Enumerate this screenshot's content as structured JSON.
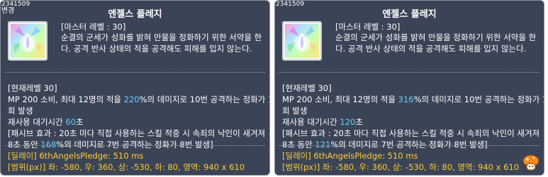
{
  "left": {
    "id": "2341509",
    "change": "변경",
    "title": "엔젤스 플레지",
    "icon": "angels-pledge-skill-icon",
    "master": "[마스터 레벨 : 30]",
    "desc1": "순결의 군세가 성화를 밝혀 만물을 정화하기 위한 서약을 한",
    "desc2": "다. 공격 반사 상태의 적을 공격해도 피해를 입지 않는다.",
    "cur_level": "[현재레벨 30]",
    "l1a": "MP 200 소비, 최대 12명의 적을 ",
    "l1v": "220",
    "l1b": "%의 데미지로 10번 공격하는 정화가 16",
    "l2": "회 발생",
    "l3a": "재사용 대기시간 ",
    "l3v": "60",
    "l3b": "초",
    "l4": "[패시브 효과 : 20초 마다 직접 사용하는 스킬 적중 시 속죄의 낙인이 새겨져",
    "l5a": "8초 동안 ",
    "l5v": "168",
    "l5b": "%의 데미지로 7번 공격하는 정화가 8번 발생]",
    "delay": "[딜레이] 6thAngelsPledge: 510 ms",
    "range": "[범위(px)] 좌: -580, 우: 360, 상: -530, 하: 80, 영역: 940 x 610"
  },
  "right": {
    "id": "2341509",
    "title": "엔젤스 플레지",
    "icon": "angels-pledge-skill-icon",
    "master": "[마스터 레벨 : 30]",
    "desc1": "순결의 군세가 성화를 밝혀 만물을 정화하기 위한 서약을 한",
    "desc2": "다. 공격 반사 상태의 적을 공격해도 피해를 입지 않는다.",
    "cur_level": "[현재레벨 30]",
    "l1a": "MP 200 소비, 최대 12명의 적을 ",
    "l1v": "316",
    "l1b": "%의 데미지로 10번 공격하는 정화가 16",
    "l2": "회 발생",
    "l3a": "재사용 대기시간 ",
    "l3v": "120",
    "l3b": "초",
    "l4": "[패시브 효과 : 20초 마다 직접 사용하는 스킬 적중 시 속죄의 낙인이 새겨져",
    "l5a": "8초 동안 ",
    "l5v": "121",
    "l5b": "%의 데미지로 7번 공격하는 정화가 8번 발생]",
    "delay": "[딜레이] 6thAngelsPledge: 510 ms",
    "range": "[범위(px)] 좌: -580, 우: 360, 상: -530, 하: 80, 영역: 940 x 610",
    "mascot": "orange-mushroom-icon"
  },
  "colors": {
    "panel_bg": "#3a4456",
    "highlight": "#66ccff",
    "info": "#ffcc33"
  }
}
